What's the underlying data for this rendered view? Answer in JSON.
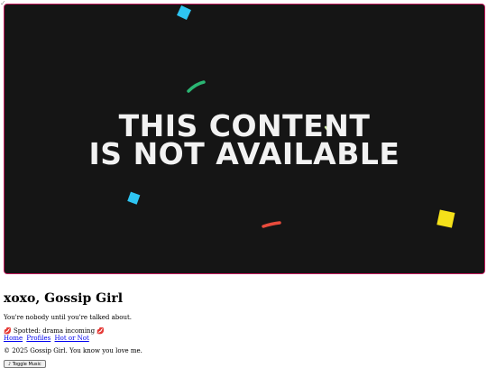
{
  "hero": {
    "line1": "THIS CONTENT",
    "line2": "IS NOT AVAILABLE",
    "confetti_colors": [
      "#2ec4f1",
      "#2bb673",
      "#e94b3c",
      "#f5e11a",
      "#cfe8a8"
    ]
  },
  "header": {
    "title": "xoxo, Gossip Girl",
    "tagline": "You're nobody until you're talked about."
  },
  "spotted": "💋 Spotted: drama incoming 💋",
  "nav": {
    "home": "Home",
    "profiles": "Profiles",
    "hot_or_not": "Hot or Not"
  },
  "footer": "© 2025 Gossip Girl. You know you love me.",
  "music_button": "♪ Toggle Music"
}
